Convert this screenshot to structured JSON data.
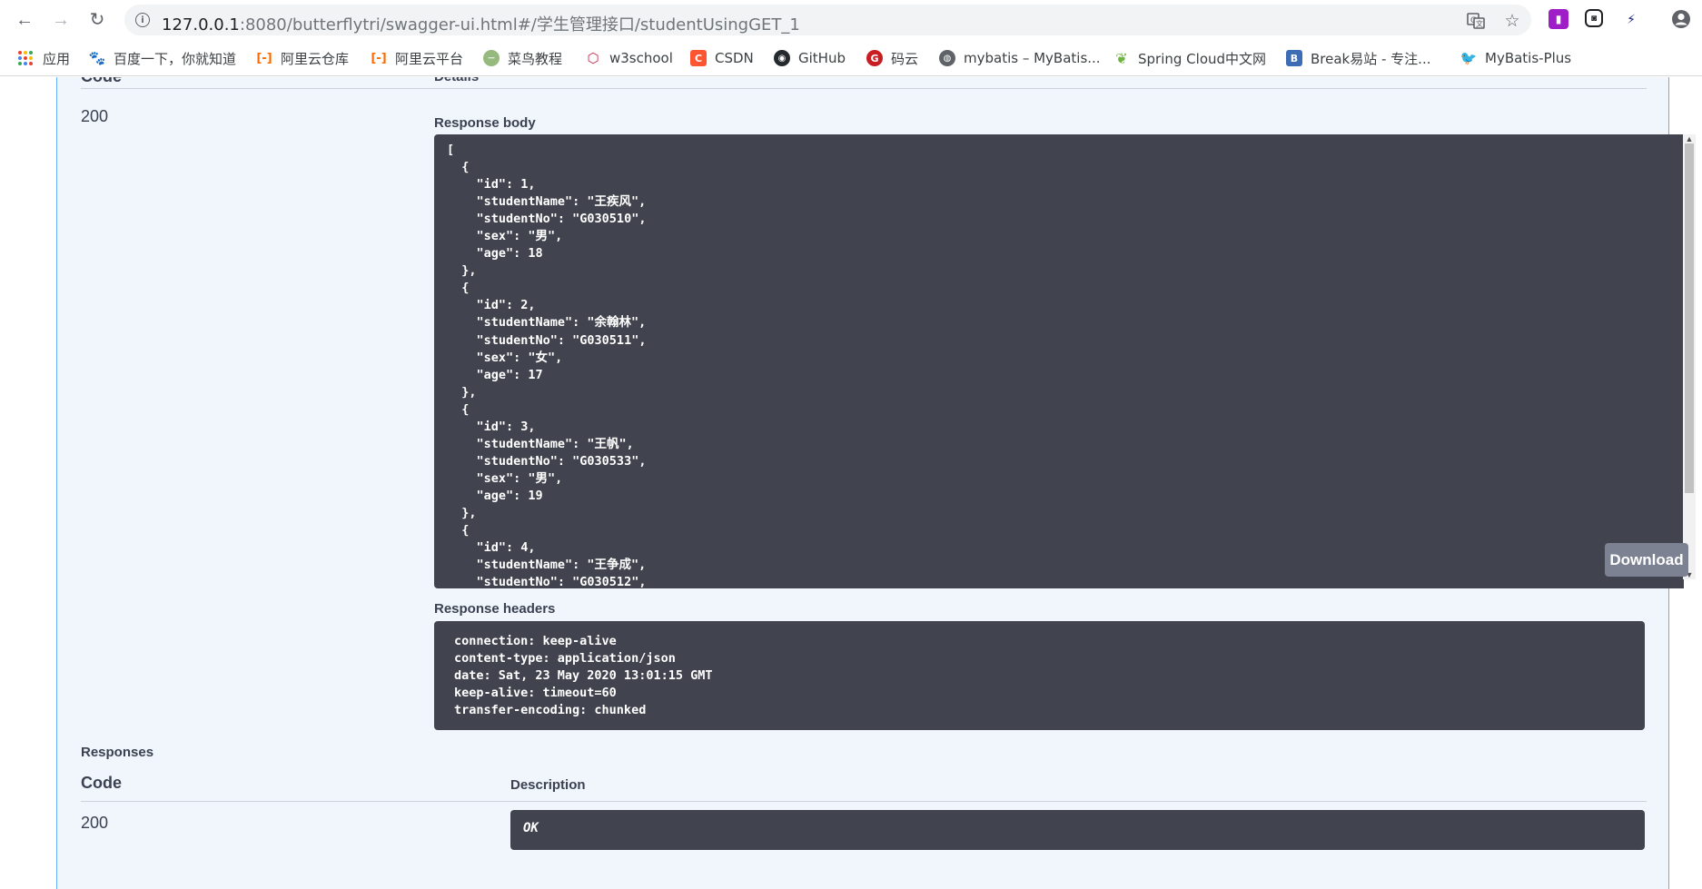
{
  "browser": {
    "url_host": "127.0.0.1",
    "url_rest": ":8080/butterflytri/swagger-ui.html#/学生管理接口/studentUsingGET_1"
  },
  "bookmarks": [
    {
      "label": "应用",
      "icon": "apps-grid-icon"
    },
    {
      "label": "百度一下，你就知道",
      "icon": "baidu-paw-icon",
      "color": "#2932e1"
    },
    {
      "label": "阿里云仓库",
      "icon": "aliyun-icon",
      "color": "#ff6a00"
    },
    {
      "label": "阿里云平台",
      "icon": "aliyun-icon",
      "color": "#ff6a00"
    },
    {
      "label": "菜鸟教程",
      "icon": "runoob-icon",
      "color": "#96b97d"
    },
    {
      "label": "w3school",
      "icon": "w3school-icon",
      "color": "#c7254e"
    },
    {
      "label": "CSDN",
      "icon": "csdn-icon",
      "color": "#fc5531"
    },
    {
      "label": "GitHub",
      "icon": "github-icon",
      "color": "#24292e"
    },
    {
      "label": "码云",
      "icon": "gitee-icon",
      "color": "#c71d23"
    },
    {
      "label": "mybatis – MyBatis...",
      "icon": "globe-icon",
      "color": "#5f6368"
    },
    {
      "label": "Spring Cloud中文网",
      "icon": "spring-leaf-icon",
      "color": "#6db33f"
    },
    {
      "label": "Break易站 - 专注...",
      "icon": "break-b-icon",
      "color": "#3d6db5"
    },
    {
      "label": "MyBatis-Plus",
      "icon": "mybatis-plus-bird-icon",
      "color": "#222222"
    }
  ],
  "server_response": {
    "code_header": "Code",
    "details_header": "Details",
    "code": "200",
    "body_label": "Response body",
    "body_text": "[\n  {\n    \"id\": 1,\n    \"studentName\": \"王疾风\",\n    \"studentNo\": \"G030510\",\n    \"sex\": \"男\",\n    \"age\": 18\n  },\n  {\n    \"id\": 2,\n    \"studentName\": \"余翰林\",\n    \"studentNo\": \"G030511\",\n    \"sex\": \"女\",\n    \"age\": 17\n  },\n  {\n    \"id\": 3,\n    \"studentName\": \"王帆\",\n    \"studentNo\": \"G030533\",\n    \"sex\": \"男\",\n    \"age\": 19\n  },\n  {\n    \"id\": 4,\n    \"studentName\": \"王争成\",\n    \"studentNo\": \"G030512\",",
    "download_label": "Download",
    "headers_label": "Response headers",
    "headers_text": "connection: keep-alive\ncontent-type: application/json\ndate: Sat, 23 May 2020 13:01:15 GMT\nkeep-alive: timeout=60\ntransfer-encoding: chunked"
  },
  "responses": {
    "title": "Responses",
    "code_header": "Code",
    "description_header": "Description",
    "code": "200",
    "description": "OK"
  },
  "colors": {
    "accent_blue": "#61affe",
    "code_bg": "#41444e",
    "download_btn": "#7d8293"
  }
}
